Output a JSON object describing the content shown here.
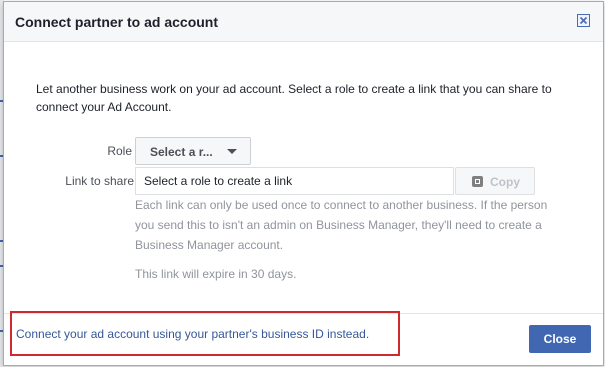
{
  "dialog": {
    "title": "Connect partner to ad account",
    "close_icon": "close-icon",
    "description": "Let another business work on your ad account. Select a role to create a link that you can share to connect your Ad Account."
  },
  "form": {
    "role_label": "Role",
    "role_value": "Select a r...",
    "link_label": "Link to share",
    "link_value": "Select a role to create a link",
    "copy_label": "Copy",
    "copy_icon": "copy-icon",
    "note": "Each link can only be used once to connect to another business. If the person you send this to isn't an admin on Business Manager, they'll need to create a Business Manager account.",
    "expiry": "This link will expire in 30 days."
  },
  "footer": {
    "partner_link": "Connect your ad account using your partner's business ID instead.",
    "close_label": "Close"
  },
  "colors": {
    "accent": "#4267b2",
    "link": "#365899",
    "highlight": "#d0282e"
  }
}
